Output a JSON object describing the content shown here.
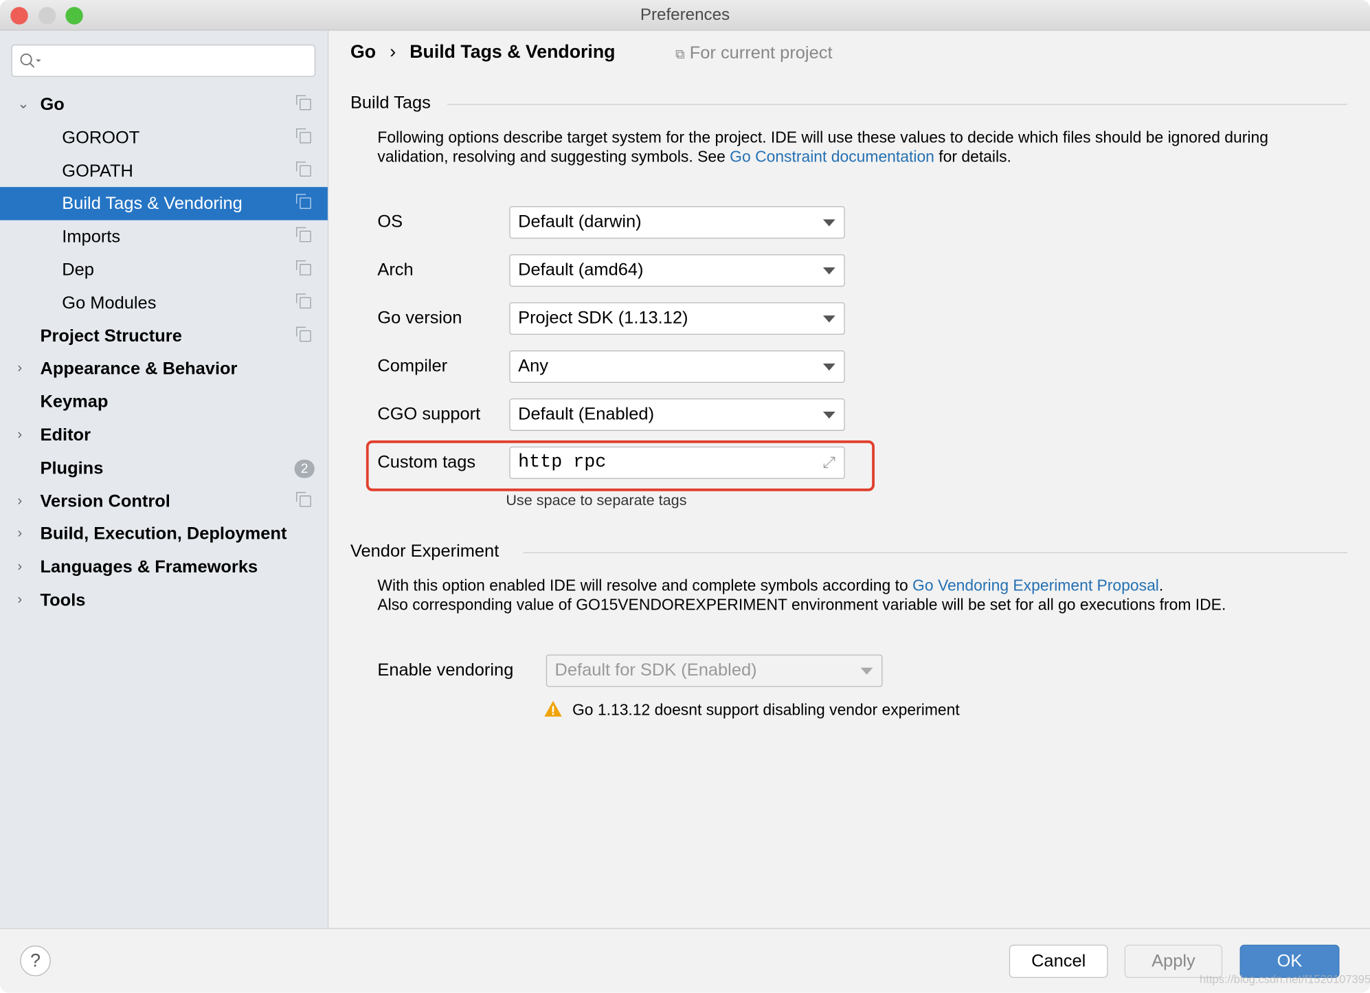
{
  "window": {
    "title": "Preferences"
  },
  "sidebar": {
    "search": {
      "placeholder": "",
      "value": ""
    },
    "items": [
      {
        "label": "Go",
        "bold": true,
        "expanded": true,
        "level": 0,
        "project": true
      },
      {
        "label": "GOROOT",
        "level": 1,
        "project": true
      },
      {
        "label": "GOPATH",
        "level": 1,
        "project": true
      },
      {
        "label": "Build Tags & Vendoring",
        "level": 1,
        "project": true,
        "selected": true
      },
      {
        "label": "Imports",
        "level": 1,
        "project": true
      },
      {
        "label": "Dep",
        "level": 1,
        "project": true
      },
      {
        "label": "Go Modules",
        "level": 1,
        "project": true
      },
      {
        "label": "Project Structure",
        "bold": true,
        "level": 0,
        "project": true
      },
      {
        "label": "Appearance & Behavior",
        "bold": true,
        "level": 0,
        "collapsed": true
      },
      {
        "label": "Keymap",
        "bold": true,
        "level": 0
      },
      {
        "label": "Editor",
        "bold": true,
        "level": 0,
        "collapsed": true
      },
      {
        "label": "Plugins",
        "bold": true,
        "level": 0,
        "badge": "2"
      },
      {
        "label": "Version Control",
        "bold": true,
        "level": 0,
        "collapsed": true,
        "project": true
      },
      {
        "label": "Build, Execution, Deployment",
        "bold": true,
        "level": 0,
        "collapsed": true
      },
      {
        "label": "Languages & Frameworks",
        "bold": true,
        "level": 0,
        "collapsed": true
      },
      {
        "label": "Tools",
        "bold": true,
        "level": 0,
        "collapsed": true
      }
    ]
  },
  "breadcrumb": {
    "root": "Go",
    "separator": "›",
    "current": "Build Tags & Vendoring",
    "scope": "For current project"
  },
  "build_tags": {
    "title": "Build Tags",
    "desc_1": "Following options describe target system for the project. IDE will use these values to decide which files should be ignored during",
    "desc_2a": "validation, resolving and suggesting symbols. See ",
    "desc_link": "Go Constraint documentation",
    "desc_2b": " for details.",
    "fields": [
      {
        "label": "OS",
        "value": "Default (darwin)"
      },
      {
        "label": "Arch",
        "value": "Default (amd64)"
      },
      {
        "label": "Go version",
        "value": "Project SDK (1.13.12)"
      },
      {
        "label": "Compiler",
        "value": "Any"
      },
      {
        "label": "CGO support",
        "value": "Default (Enabled)"
      }
    ],
    "custom_tags": {
      "label": "Custom tags",
      "value": "http rpc",
      "hint": "Use space to separate tags"
    }
  },
  "vendor": {
    "title": "Vendor Experiment",
    "desc_1a": "With this option enabled IDE will resolve and complete symbols according to ",
    "desc_link": "Go Vendoring Experiment Proposal",
    "desc_1b": ".",
    "desc_2": "Also corresponding value of GO15VENDOREXPERIMENT environment variable will be set for all go executions from IDE.",
    "enable_label": "Enable vendoring",
    "enable_value": "Default for SDK (Enabled)",
    "warning": "Go 1.13.12 doesnt support disabling vendor experiment"
  },
  "footer": {
    "help": "?",
    "cancel": "Cancel",
    "apply": "Apply",
    "ok": "OK",
    "watermark": "https://blog.csdn.net/f1520107395"
  },
  "colors": {
    "accent": "#2675c5",
    "highlight": "#e0402e",
    "link": "#2470b3",
    "ok": "#4a88cb"
  }
}
